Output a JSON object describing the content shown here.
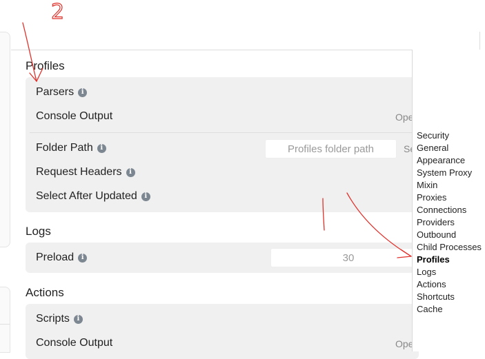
{
  "annotation_text": "2",
  "profiles": {
    "title": "Profiles",
    "parsers_label": "Parsers",
    "console_output_label": "Console Output",
    "console_output_side": "Ope",
    "folder_path_label": "Folder Path",
    "folder_path_placeholder": "Profiles folder path",
    "folder_path_side": "Se",
    "request_headers_label": "Request Headers",
    "select_after_updated_label": "Select After Updated"
  },
  "logs": {
    "title": "Logs",
    "preload_label": "Preload",
    "preload_value": "30"
  },
  "actions": {
    "title": "Actions",
    "scripts_label": "Scripts",
    "console_output_label": "Console Output",
    "console_output_side": "Ope"
  },
  "nav": {
    "items": [
      {
        "label": "Security"
      },
      {
        "label": "General"
      },
      {
        "label": "Appearance"
      },
      {
        "label": "System Proxy"
      },
      {
        "label": "Mixin"
      },
      {
        "label": "Proxies"
      },
      {
        "label": "Connections"
      },
      {
        "label": "Providers"
      },
      {
        "label": "Outbound"
      },
      {
        "label": "Child Processes"
      },
      {
        "label": "Profiles"
      },
      {
        "label": "Logs"
      },
      {
        "label": "Actions"
      },
      {
        "label": "Shortcuts"
      },
      {
        "label": "Cache"
      }
    ],
    "active": "Profiles"
  },
  "colors": {
    "annotation": "#e0302a",
    "card_background": "#f0f0f0",
    "info_icon": "#7d8791"
  }
}
